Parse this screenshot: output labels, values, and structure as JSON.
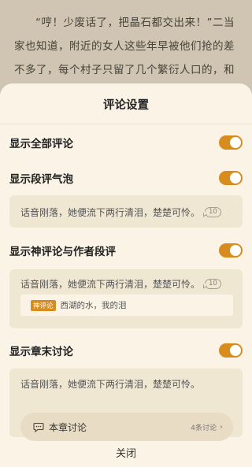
{
  "reader": {
    "paragraph": "“哼！少废话了，把晶石都交出来！”二当家也知道，附近的女人这些年早被他们抢的差不多了，每个村子只留了几个繁衍人口的，和"
  },
  "sheet": {
    "title": "评论设置",
    "close_label": "关闭",
    "accent_color": "#d98c1e",
    "settings": [
      {
        "label": "显示全部评论",
        "enabled": true
      },
      {
        "label": "显示段评气泡",
        "enabled": true
      },
      {
        "label": "显示神评论与作者段评",
        "enabled": true
      },
      {
        "label": "显示章末讨论",
        "enabled": true
      }
    ],
    "previews": {
      "bubble": {
        "text": "话音刚落，她便流下两行清泪，楚楚可怜。",
        "count": "10"
      },
      "god": {
        "text": "话音刚落，她便流下两行清泪，楚楚可怜。",
        "count": "10",
        "badge": "神评论",
        "comment": "西湖的水，我的泪"
      },
      "chapter": {
        "text": "话音刚落，她便流下两行清泪，楚楚可怜。",
        "card_label": "本章讨论",
        "card_count": "4条讨论"
      }
    }
  }
}
